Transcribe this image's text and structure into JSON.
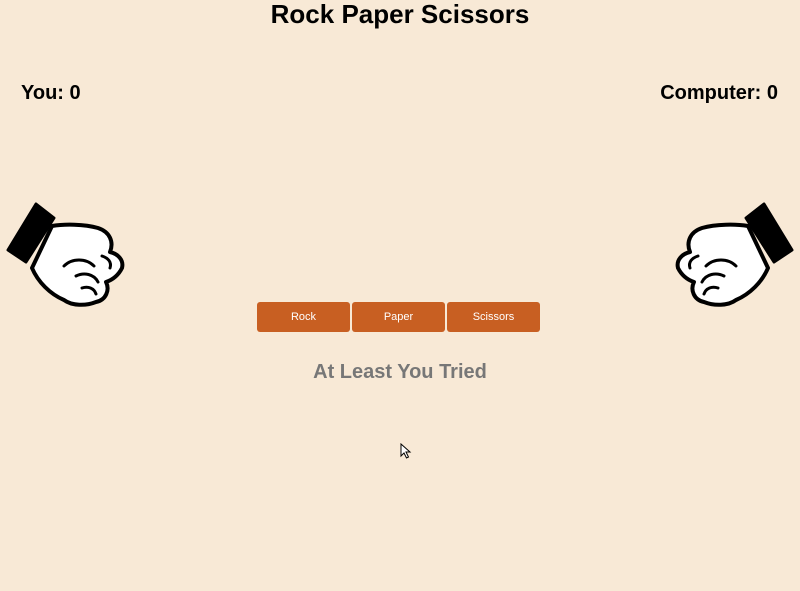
{
  "header": {
    "title": "Rock Paper Scissors"
  },
  "scores": {
    "you": "You: 0",
    "computer": "Computer: 0"
  },
  "hands": {
    "player": "fist-icon",
    "computer": "fist-icon"
  },
  "buttons": {
    "rock": "Rock",
    "paper": "Paper",
    "scissors": "Scissors"
  },
  "result": {
    "message": "At Least You Tried"
  },
  "colors": {
    "background": "#f8e9d6",
    "button": "#c85f22",
    "result_text": "#777777"
  }
}
